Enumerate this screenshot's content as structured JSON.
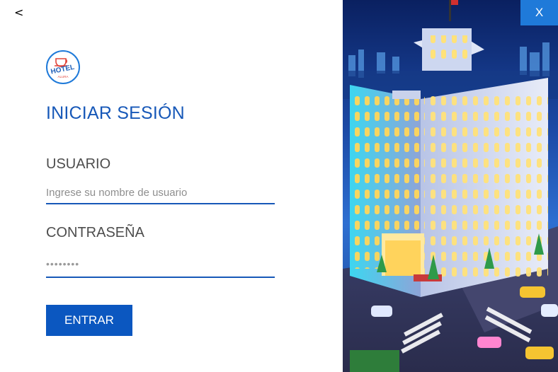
{
  "nav": {
    "back_label": "<",
    "close_label": "X"
  },
  "logo": {
    "top_text": "HOTEL",
    "bottom_text": "ALURA"
  },
  "form": {
    "title": "INICIAR SESIÓN",
    "username_label": "USUARIO",
    "username_placeholder": "Ingrese su nombre de usuario",
    "password_label": "CONTRASEÑA",
    "password_value": "••••••••",
    "submit_label": "ENTRAR"
  },
  "colors": {
    "accent": "#1758b8",
    "button": "#0b57c0",
    "close": "#1f7ad9"
  },
  "icons": [
    "hotel-logo-icon",
    "hotel-illustration"
  ]
}
